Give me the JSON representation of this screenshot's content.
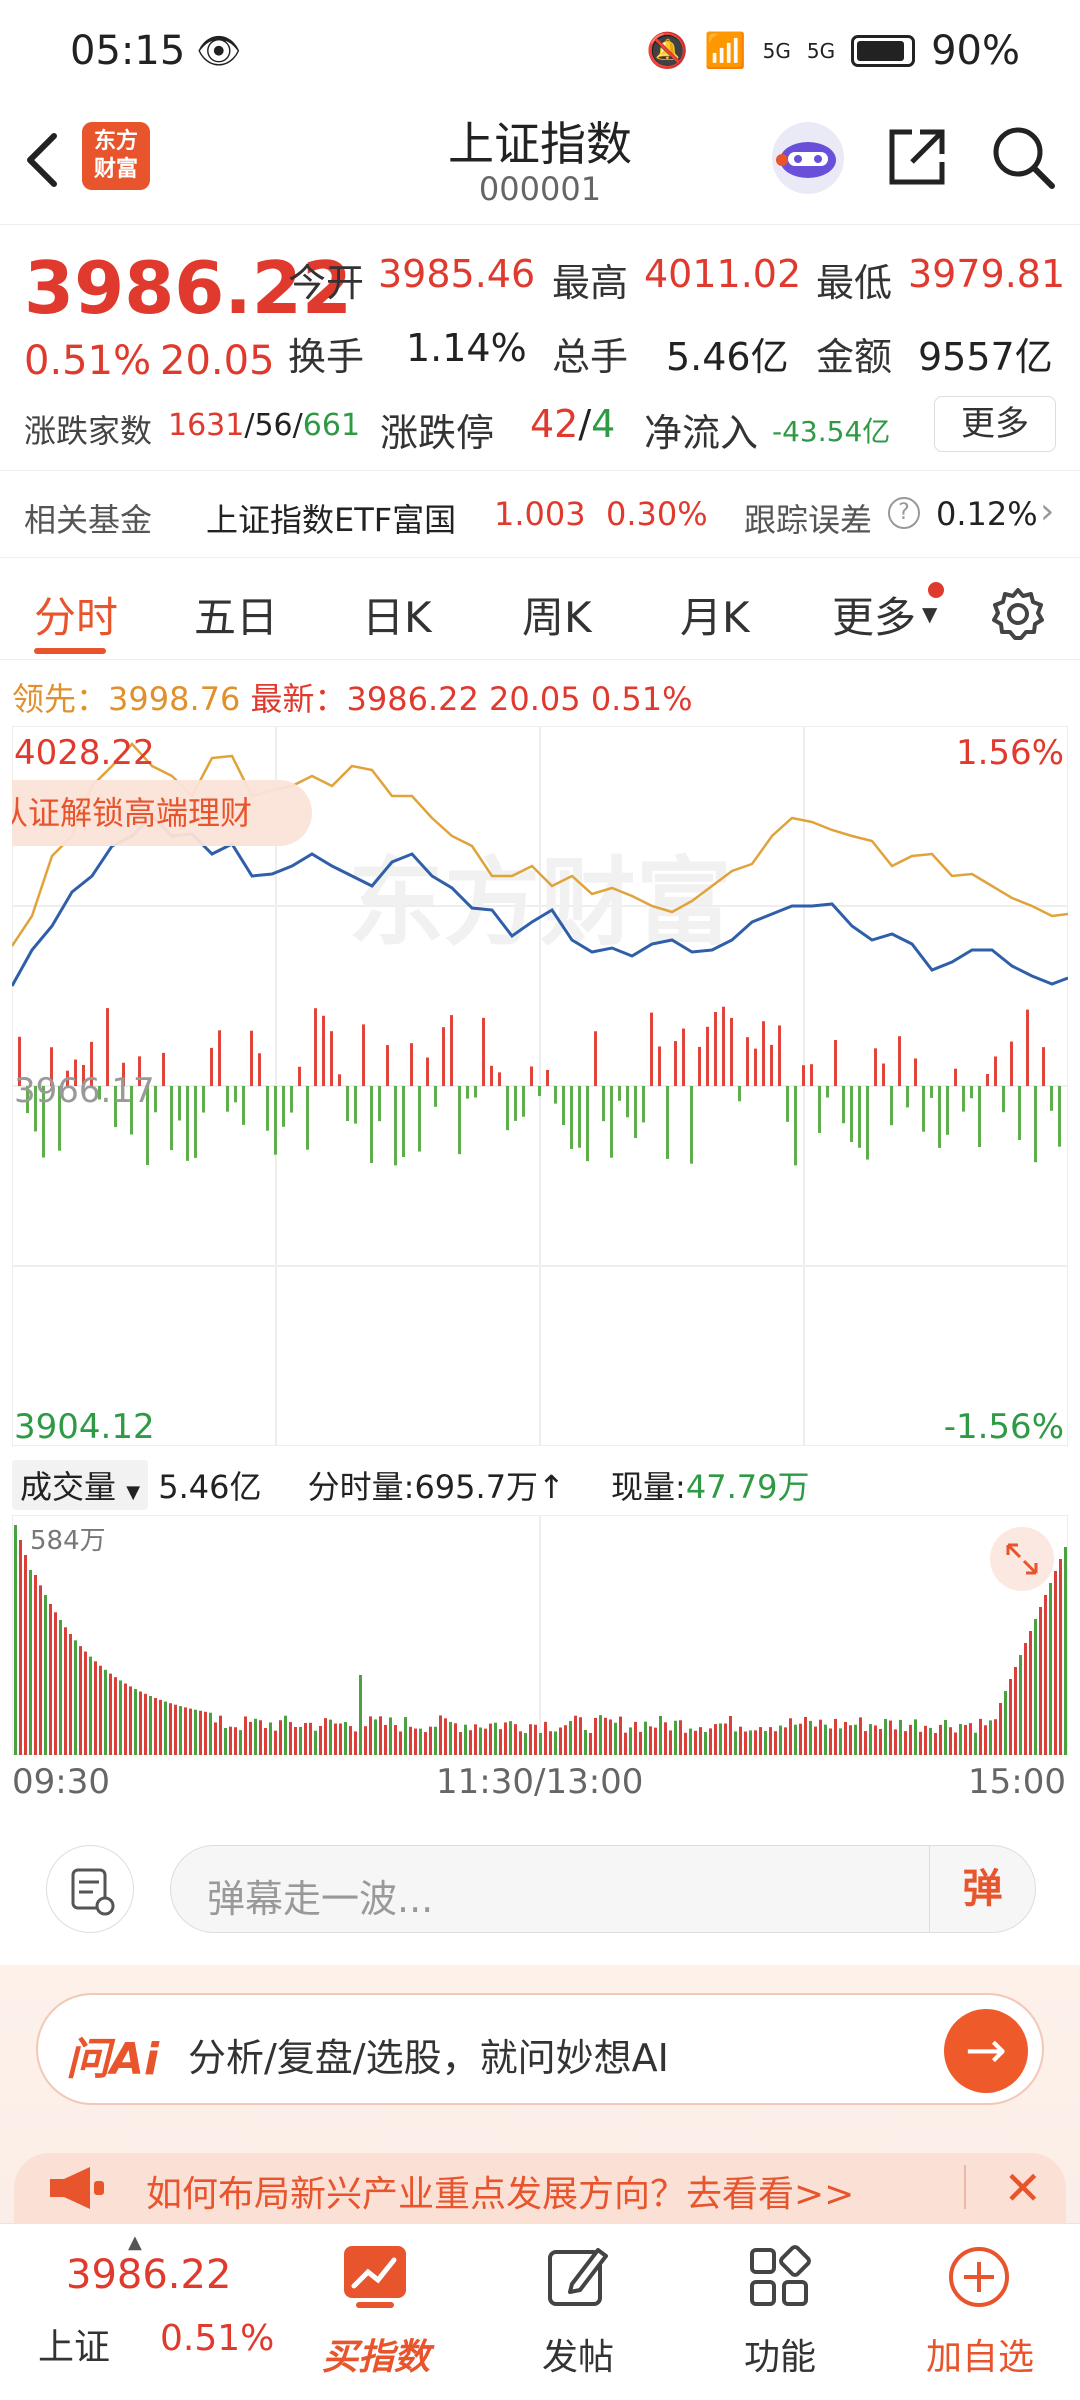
{
  "status": {
    "time": "05:15",
    "battery": "90%",
    "net1": "5G",
    "net2": "5G"
  },
  "header": {
    "logo_line1": "东方",
    "logo_line2": "财富",
    "title": "上证指数",
    "code": "000001"
  },
  "quote": {
    "price": "3986.22",
    "pct": "0.51%",
    "chg": "20.05",
    "open_label": "今开",
    "open": "3985.46",
    "high_label": "最高",
    "high": "4011.02",
    "low_label": "最低",
    "low": "3979.81",
    "turnover_label": "换手",
    "turnover": "1.14%",
    "volume_label": "总手",
    "volume": "5.46亿",
    "amount_label": "金额",
    "amount": "9557亿",
    "breadth_label": "涨跌家数",
    "breadth_up": "1631",
    "breadth_flat": "56",
    "breadth_down": "661",
    "limit_label": "涨跌停",
    "limit_up": "42",
    "limit_down": "4",
    "inflow_label": "净流入",
    "inflow": "-43.54亿",
    "more": "更多"
  },
  "fund": {
    "label": "相关基金",
    "name": "上证指数ETF富国",
    "price": "1.003",
    "pct": "0.30%",
    "err_label": "跟踪误差",
    "err": "0.12%"
  },
  "tabs": [
    "分时",
    "五日",
    "日K",
    "周K",
    "月K",
    "更多"
  ],
  "chart": {
    "lead_label": "领先：",
    "lead": "3998.76",
    "latest_label": "最新：",
    "latest": "3986.22",
    "latest_chg": "20.05",
    "latest_pct": "0.51%",
    "y_top": "4028.22",
    "y_mid": "3966.17",
    "y_bottom": "3904.12",
    "pct_top": "1.56%",
    "pct_bottom": "-1.56%",
    "promo": "认证解锁高端理财",
    "watermark": "东方财富",
    "vol_label": "成交量",
    "vol_total": "5.46亿",
    "vol_time_label": "分时量:",
    "vol_time": "695.7万↑",
    "vol_now_label": "现量:",
    "vol_now": "47.79万",
    "vol_max": "584万",
    "t_start": "09:30",
    "t_mid": "11:30/13:00",
    "t_end": "15:00"
  },
  "comment": {
    "placeholder": "弹幕走一波...",
    "danmu": "弹"
  },
  "ai": {
    "logo": "问Ai",
    "text": "分析/复盘/选股，就问妙想AI",
    "ann": "如何布局新兴产业重点发展方向？去看看>>"
  },
  "nav": {
    "index_price": "3986.22",
    "index_name": "上证",
    "index_pct": "0.51%",
    "items": [
      "买指数",
      "发帖",
      "功能",
      "加自选"
    ]
  },
  "chart_data": {
    "type": "line",
    "series": [
      {
        "name": "领先",
        "color": "#e0a33a"
      },
      {
        "name": "最新",
        "color": "#2f5fa8"
      }
    ],
    "ylim": [
      3904.12,
      4028.22
    ]
  }
}
